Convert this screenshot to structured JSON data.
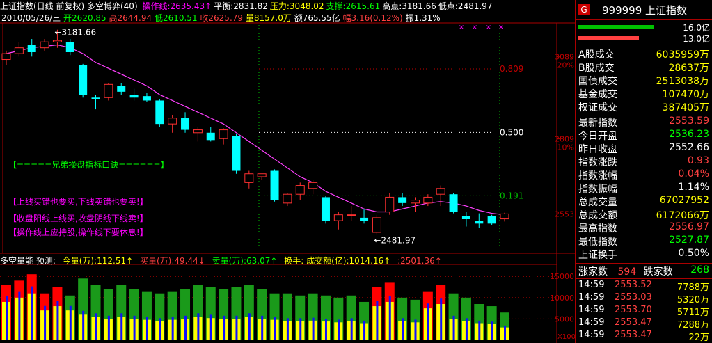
{
  "header": {
    "title": "上证指数(日线 前复权) 多空博弈(40)",
    "items": [
      {
        "text": "操作线:2635.43↑",
        "color": "#ff00ff"
      },
      {
        "text": "平衡:2831.82",
        "color": "#ffffff"
      },
      {
        "text": "压力:3048.02",
        "color": "#ffff00"
      },
      {
        "text": "支撑:2615.61",
        "color": "#00ff00"
      },
      {
        "text": "高点:3181.66",
        "color": "#ffffff"
      },
      {
        "text": "低点:2481.97",
        "color": "#ffffff"
      }
    ]
  },
  "info": {
    "date": "2010/05/26/三",
    "open": "开2620.85",
    "high": "高2644.94",
    "low": "低2610.51",
    "close": "收2625.79",
    "vol": "量8157.0万",
    "amount": "额765.55亿",
    "range": "幅3.16(0.12%)",
    "amp": "振1.31%"
  },
  "annotations": {
    "high_label": "←3181.66",
    "low_label": "←2481.97",
    "level_0809": "0.809",
    "level_0500": "0.500",
    "level_0191": "0.191",
    "axis_3089": "3089",
    "axis_20pct": "20%",
    "axis_2809": "2809",
    "axis_10pct": "10%",
    "axis_2553": "2553",
    "vol_15000": "15000",
    "vol_10000": "10000",
    "vol_5000": "5000",
    "vol_x100": "X100"
  },
  "messages": [
    "【=====兄弟操盘指标口诀======】",
    "【上线买错也要买,下线卖错也要卖!】",
    "【收盘阳线上线买,收盘阴线下线卖!】",
    "【操作线上应持股,操作线下要休息!】"
  ],
  "volume_header": {
    "name": "多空量能 预测:",
    "total": "今量(万):112.51↑",
    "buy": "买量(万):49.44↓",
    "sell": "卖量(万):63.07↑",
    "turnover": "换手: 成交额(亿):1014.16↑",
    "extra": ":2501.36↑"
  },
  "panel": {
    "badge": "G",
    "code_name": "999999 上证指数",
    "bar1_label": "16.0亿",
    "bar2_label": "13.0亿",
    "bar1_fill": 0.72,
    "bar2_fill": 0.58,
    "rows1": [
      {
        "label": "A股成交",
        "value": "6035959万",
        "color": "#ffff00"
      },
      {
        "label": "B股成交",
        "value": "28637万",
        "color": "#ffff00"
      },
      {
        "label": "国债成交",
        "value": "2513038万",
        "color": "#ffff00"
      },
      {
        "label": "基金成交",
        "value": "107470万",
        "color": "#ffff00"
      },
      {
        "label": "权证成交",
        "value": "387405万",
        "color": "#ffff00"
      }
    ],
    "rows2": [
      {
        "label": "最新指数",
        "value": "2553.59",
        "color": "#ff4040"
      },
      {
        "label": "今日开盘",
        "value": "2536.23",
        "color": "#00ff00"
      },
      {
        "label": "昨日收盘",
        "value": "2552.66",
        "color": "#ffffff"
      },
      {
        "label": "指数涨跌",
        "value": "0.93",
        "color": "#ff4040"
      },
      {
        "label": "指数涨幅",
        "value": "0.04%",
        "color": "#ff4040"
      },
      {
        "label": "指数振幅",
        "value": "1.14%",
        "color": "#ffffff"
      },
      {
        "label": "总成交量",
        "value": "67027952",
        "color": "#ffff00"
      },
      {
        "label": "总成交额",
        "value": "6172066万",
        "color": "#ffff00"
      },
      {
        "label": "最高指数",
        "value": "2556.97",
        "color": "#ff4040"
      },
      {
        "label": "最低指数",
        "value": "2527.87",
        "color": "#00ff00"
      },
      {
        "label": "上证换手",
        "value": "0.50%",
        "color": "#ffffff"
      }
    ],
    "up_label": "涨家数",
    "up_count": "594",
    "down_label": "跌家数",
    "down_count": "268",
    "ticks": [
      {
        "time": "14:59",
        "price": "2553.52",
        "vol": "7788万"
      },
      {
        "time": "14:59",
        "price": "2553.03",
        "vol": "5320万"
      },
      {
        "time": "14:59",
        "price": "2553.70",
        "vol": "5711万"
      },
      {
        "time": "14:59",
        "price": "2553.47",
        "vol": "7288万"
      },
      {
        "time": "14:59",
        "price": "2553.47",
        "vol": "22万"
      }
    ]
  },
  "chart_data": {
    "type": "candlestick",
    "ylim": [
      2440,
      3200
    ],
    "candles": [
      {
        "o": 3080,
        "c": 3100,
        "h": 3110,
        "l": 3060
      },
      {
        "o": 3100,
        "c": 3120,
        "h": 3140,
        "l": 3090
      },
      {
        "o": 3130,
        "c": 3105,
        "h": 3150,
        "l": 3090
      },
      {
        "o": 3120,
        "c": 3140,
        "h": 3150,
        "l": 3110
      },
      {
        "o": 3140,
        "c": 3145,
        "h": 3181.66,
        "l": 3120
      },
      {
        "o": 3140,
        "c": 3105,
        "h": 3150,
        "l": 3095
      },
      {
        "o": 3060,
        "c": 2960,
        "h": 3065,
        "l": 2950
      },
      {
        "o": 2950,
        "c": 2945,
        "h": 2960,
        "l": 2910
      },
      {
        "o": 2950,
        "c": 2995,
        "h": 3000,
        "l": 2940
      },
      {
        "o": 2990,
        "c": 2970,
        "h": 3000,
        "l": 2960
      },
      {
        "o": 2960,
        "c": 2950,
        "h": 2980,
        "l": 2940
      },
      {
        "o": 2955,
        "c": 2940,
        "h": 2965,
        "l": 2935
      },
      {
        "o": 2940,
        "c": 2860,
        "h": 2945,
        "l": 2850
      },
      {
        "o": 2860,
        "c": 2880,
        "h": 2890,
        "l": 2830
      },
      {
        "o": 2880,
        "c": 2840,
        "h": 2900,
        "l": 2830
      },
      {
        "o": 2830,
        "c": 2840,
        "h": 2850,
        "l": 2800
      },
      {
        "o": 2830,
        "c": 2805,
        "h": 2850,
        "l": 2800
      },
      {
        "o": 2810,
        "c": 2840,
        "h": 2845,
        "l": 2790
      },
      {
        "o": 2820,
        "c": 2700,
        "h": 2825,
        "l": 2690
      },
      {
        "o": 2660,
        "c": 2690,
        "h": 2700,
        "l": 2640
      },
      {
        "o": 2680,
        "c": 2690,
        "h": 2690,
        "l": 2670
      },
      {
        "o": 2700,
        "c": 2600,
        "h": 2705,
        "l": 2595
      },
      {
        "o": 2590,
        "c": 2620,
        "h": 2625,
        "l": 2580
      },
      {
        "o": 2620,
        "c": 2650,
        "h": 2660,
        "l": 2600
      },
      {
        "o": 2640,
        "c": 2660,
        "h": 2670,
        "l": 2620
      },
      {
        "o": 2610,
        "c": 2530,
        "h": 2615,
        "l": 2520
      },
      {
        "o": 2530,
        "c": 2550,
        "h": 2560,
        "l": 2500
      },
      {
        "o": 2550,
        "c": 2550,
        "h": 2580,
        "l": 2530
      },
      {
        "o": 2540,
        "c": 2530,
        "h": 2570,
        "l": 2520
      },
      {
        "o": 2490,
        "c": 2540,
        "h": 2550,
        "l": 2481.97
      },
      {
        "o": 2560,
        "c": 2610,
        "h": 2625,
        "l": 2550
      },
      {
        "o": 2610,
        "c": 2590,
        "h": 2625,
        "l": 2580
      },
      {
        "o": 2590,
        "c": 2600,
        "h": 2610,
        "l": 2560
      },
      {
        "o": 2590,
        "c": 2610,
        "h": 2620,
        "l": 2580
      },
      {
        "o": 2620,
        "c": 2640,
        "h": 2650,
        "l": 2580
      },
      {
        "o": 2620,
        "c": 2560,
        "h": 2625,
        "l": 2555
      },
      {
        "o": 2545,
        "c": 2535,
        "h": 2560,
        "l": 2510
      },
      {
        "o": 2530,
        "c": 2520,
        "h": 2555,
        "l": 2505
      },
      {
        "o": 2545,
        "c": 2520,
        "h": 2550,
        "l": 2515
      },
      {
        "o": 2536,
        "c": 2553,
        "h": 2557,
        "l": 2527
      }
    ],
    "ma": [
      3100,
      3110,
      3120,
      3125,
      3130,
      3120,
      3100,
      3070,
      3050,
      3030,
      3010,
      2990,
      2960,
      2940,
      2920,
      2900,
      2880,
      2860,
      2830,
      2800,
      2770,
      2740,
      2710,
      2680,
      2660,
      2630,
      2610,
      2590,
      2570,
      2560,
      2560,
      2570,
      2580,
      2590,
      2595,
      2590,
      2580,
      2565,
      2555,
      2550
    ],
    "volume": [
      {
        "total": 13000,
        "buy": 9000,
        "color": "red"
      },
      {
        "total": 14000,
        "buy": 10000,
        "color": "red"
      },
      {
        "total": 15500,
        "buy": 11000,
        "color": "red"
      },
      {
        "total": 11000,
        "buy": 7000,
        "color": "red"
      },
      {
        "total": 12500,
        "buy": 8000,
        "color": "red"
      },
      {
        "total": 10500,
        "buy": 7000,
        "color": "green"
      },
      {
        "total": 14500,
        "buy": 6000,
        "color": "green"
      },
      {
        "total": 13000,
        "buy": 5500,
        "color": "green"
      },
      {
        "total": 12000,
        "buy": 5000,
        "color": "green"
      },
      {
        "total": 13000,
        "buy": 5500,
        "color": "green"
      },
      {
        "total": 12000,
        "buy": 5000,
        "color": "green"
      },
      {
        "total": 11500,
        "buy": 4800,
        "color": "green"
      },
      {
        "total": 11000,
        "buy": 4500,
        "color": "green"
      },
      {
        "total": 11500,
        "buy": 4800,
        "color": "green"
      },
      {
        "total": 12000,
        "buy": 5000,
        "color": "green"
      },
      {
        "total": 13000,
        "buy": 5500,
        "color": "green"
      },
      {
        "total": 12500,
        "buy": 5200,
        "color": "green"
      },
      {
        "total": 12000,
        "buy": 5000,
        "color": "green"
      },
      {
        "total": 12500,
        "buy": 5000,
        "color": "green"
      },
      {
        "total": 13000,
        "buy": 5500,
        "color": "green"
      },
      {
        "total": 12000,
        "buy": 5000,
        "color": "green"
      },
      {
        "total": 11000,
        "buy": 4800,
        "color": "green"
      },
      {
        "total": 11000,
        "buy": 4500,
        "color": "green"
      },
      {
        "total": 10500,
        "buy": 4500,
        "color": "green"
      },
      {
        "total": 11000,
        "buy": 4600,
        "color": "green"
      },
      {
        "total": 10500,
        "buy": 4400,
        "color": "green"
      },
      {
        "total": 10000,
        "buy": 4200,
        "color": "green"
      },
      {
        "total": 10500,
        "buy": 4500,
        "color": "green"
      },
      {
        "total": 9000,
        "buy": 4000,
        "color": "green"
      },
      {
        "total": 12500,
        "buy": 8000,
        "color": "red"
      },
      {
        "total": 13500,
        "buy": 9000,
        "color": "red"
      },
      {
        "total": 10000,
        "buy": 4500,
        "color": "green"
      },
      {
        "total": 9500,
        "buy": 4200,
        "color": "green"
      },
      {
        "total": 11500,
        "buy": 7500,
        "color": "red"
      },
      {
        "total": 13000,
        "buy": 8500,
        "color": "red"
      },
      {
        "total": 11000,
        "buy": 5000,
        "color": "green"
      },
      {
        "total": 10000,
        "buy": 4500,
        "color": "green"
      },
      {
        "total": 8500,
        "buy": 4000,
        "color": "green"
      },
      {
        "total": 8000,
        "buy": 3800,
        "color": "green"
      },
      {
        "total": 6500,
        "buy": 3000,
        "color": "green"
      }
    ]
  }
}
